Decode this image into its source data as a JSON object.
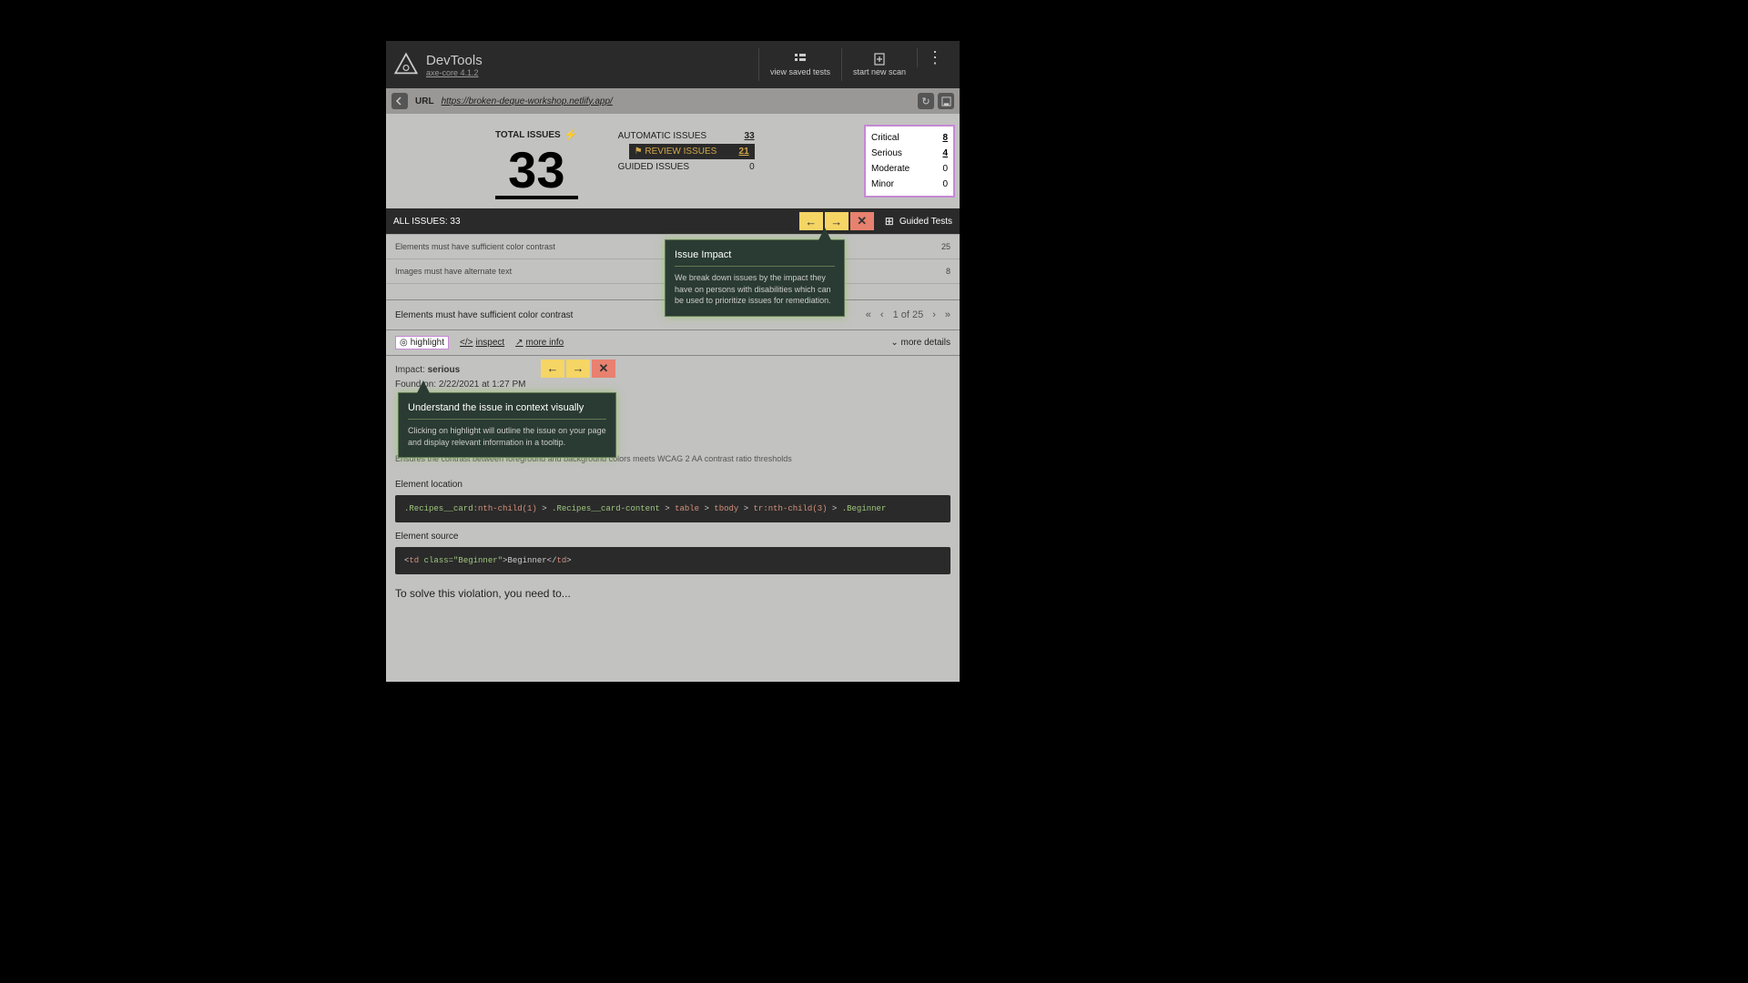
{
  "header": {
    "title": "DevTools",
    "subtitle": "axe-core 4.1.2",
    "view_saved": "view saved tests",
    "start_new": "start new scan"
  },
  "url_bar": {
    "label": "URL",
    "url": "https://broken-deque-workshop.netlify.app/"
  },
  "summary": {
    "total_label": "TOTAL ISSUES",
    "total_value": "33",
    "automatic_label": "AUTOMATIC ISSUES",
    "automatic_value": "33",
    "review_label": "REVIEW ISSUES",
    "review_value": "21",
    "guided_label": "GUIDED ISSUES",
    "guided_value": "0"
  },
  "severity": {
    "rows": [
      {
        "label": "Critical",
        "value": "8"
      },
      {
        "label": "Serious",
        "value": "4"
      },
      {
        "label": "Moderate",
        "value": "0"
      },
      {
        "label": "Minor",
        "value": "0"
      }
    ]
  },
  "issues_bar": {
    "title": "ALL ISSUES: 33",
    "guided": "Guided Tests"
  },
  "issue_list": [
    {
      "name": "Elements must have sufficient color contrast",
      "count": "25"
    },
    {
      "name": "Images must have alternate text",
      "count": "8"
    }
  ],
  "detail": {
    "title": "Elements must have sufficient color contrast",
    "pager": "1 of 25"
  },
  "actions": {
    "highlight": "highlight",
    "inspect": "inspect",
    "more_info": "more info",
    "more_details": "more details"
  },
  "meta": {
    "impact_label": "Impact:",
    "impact_value": "serious",
    "found_label": "Found on:",
    "found_value": "2/22/2021 at 1:27 PM"
  },
  "description": {
    "text": "Ensures the contrast between foreground and background colors meets WCAG 2 AA contrast ratio thresholds"
  },
  "location": {
    "label": "Element location"
  },
  "source": {
    "label": "Element source"
  },
  "solve": {
    "label": "To solve this violation, you need to..."
  },
  "tooltip1": {
    "title": "Issue Impact",
    "body": "We break down issues by the impact they have on persons with disabilities which can be used to prioritize issues for remediation."
  },
  "tooltip2": {
    "title": "Understand the issue in context visually",
    "body": "Clicking on highlight will outline the issue on your page and display relevant information in a tooltip."
  },
  "code": {
    "location": ".Recipes__card:nth-child(1) > .Recipes__card-content > table > tbody > tr:nth-child(3) > .Beginner",
    "source": "<td class=\"Beginner\">Beginner</td>"
  }
}
